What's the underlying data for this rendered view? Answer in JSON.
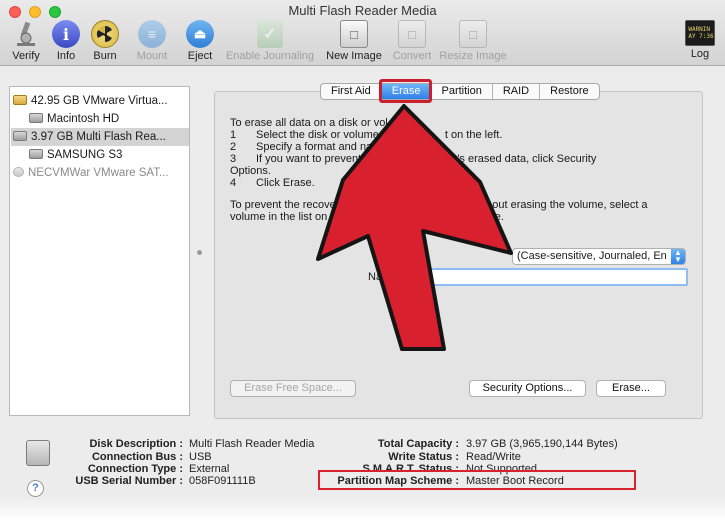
{
  "window": {
    "title": "Multi Flash Reader Media"
  },
  "toolbar": {
    "items": [
      {
        "label": "Verify",
        "icon": "microscope-icon",
        "enabled": true
      },
      {
        "label": "Info",
        "icon": "info-icon",
        "enabled": true
      },
      {
        "label": "Burn",
        "icon": "burn-icon",
        "enabled": true
      },
      {
        "label": "Mount",
        "icon": "mount-icon",
        "enabled": false
      },
      {
        "label": "Eject",
        "icon": "eject-icon",
        "enabled": true
      },
      {
        "label": "Enable Journaling",
        "icon": "journaling-icon",
        "enabled": false
      },
      {
        "label": "New Image",
        "icon": "new-image-icon",
        "enabled": true
      },
      {
        "label": "Convert",
        "icon": "convert-icon",
        "enabled": false
      },
      {
        "label": "Resize Image",
        "icon": "resize-image-icon",
        "enabled": false
      },
      {
        "label": "Log",
        "icon": "log-icon",
        "enabled": true
      }
    ],
    "log_icon_text": "WARNIN\nAY 7:36"
  },
  "sidebar": {
    "items": [
      {
        "label": "42.95 GB VMware Virtua...",
        "level": 0,
        "state": "normal"
      },
      {
        "label": "Macintosh HD",
        "level": 1,
        "state": "normal"
      },
      {
        "label": "3.97 GB Multi Flash Rea...",
        "level": 0,
        "state": "selected"
      },
      {
        "label": "SAMSUNG S3",
        "level": 1,
        "state": "normal"
      },
      {
        "label": "NECVMWar VMware SAT...",
        "level": 0,
        "state": "gray"
      }
    ]
  },
  "tabs": [
    "First Aid",
    "Erase",
    "Partition",
    "RAID",
    "Restore"
  ],
  "active_tab": "Erase",
  "erase": {
    "intro": "To erase all data on a disk or vol",
    "steps": [
      {
        "num": "1",
        "text": "Select the disk or volume",
        "tail": "t on the left."
      },
      {
        "num": "2",
        "text": "Specify a format and nam",
        "tail": ""
      },
      {
        "num": "3",
        "text": "If you want to prevent th",
        "tail": "the disk's erased data, click Security"
      }
    ],
    "step3_cont": "Options.",
    "step4": {
      "num": "4",
      "text": "Click Erase."
    },
    "para2_line1a": "To prevent the recovery o",
    "para2_line1b": "s without erasing the volume, select a",
    "para2_line2a": "volume in the list on the",
    "para2_line2b": "Space.",
    "format_value": "(Case-sensitive, Journaled, En",
    "name_label": "Name",
    "name_value": "",
    "buttons": {
      "erase_free_space": "Erase Free Space...",
      "security_options": "Security Options...",
      "erase": "Erase..."
    }
  },
  "info": {
    "left": [
      {
        "key": "Disk Description :",
        "value": "Multi Flash Reader Media"
      },
      {
        "key": "Connection Bus :",
        "value": "USB"
      },
      {
        "key": "Connection Type :",
        "value": "External"
      },
      {
        "key": "USB Serial Number :",
        "value": "058F091111B"
      }
    ],
    "right": [
      {
        "key": "Total Capacity :",
        "value": "3.97 GB (3,965,190,144 Bytes)"
      },
      {
        "key": "Write Status :",
        "value": "Read/Write"
      },
      {
        "key": "S.M.A.R.T. Status :",
        "value": "Not Supported"
      },
      {
        "key": "Partition Map Scheme :",
        "value": "Master Boot Record"
      }
    ]
  },
  "help": "?",
  "colors": {
    "annotation_red": "#d8222f",
    "arrow_fill": "#d9202e",
    "selected_tab": "#2f7fe8"
  }
}
